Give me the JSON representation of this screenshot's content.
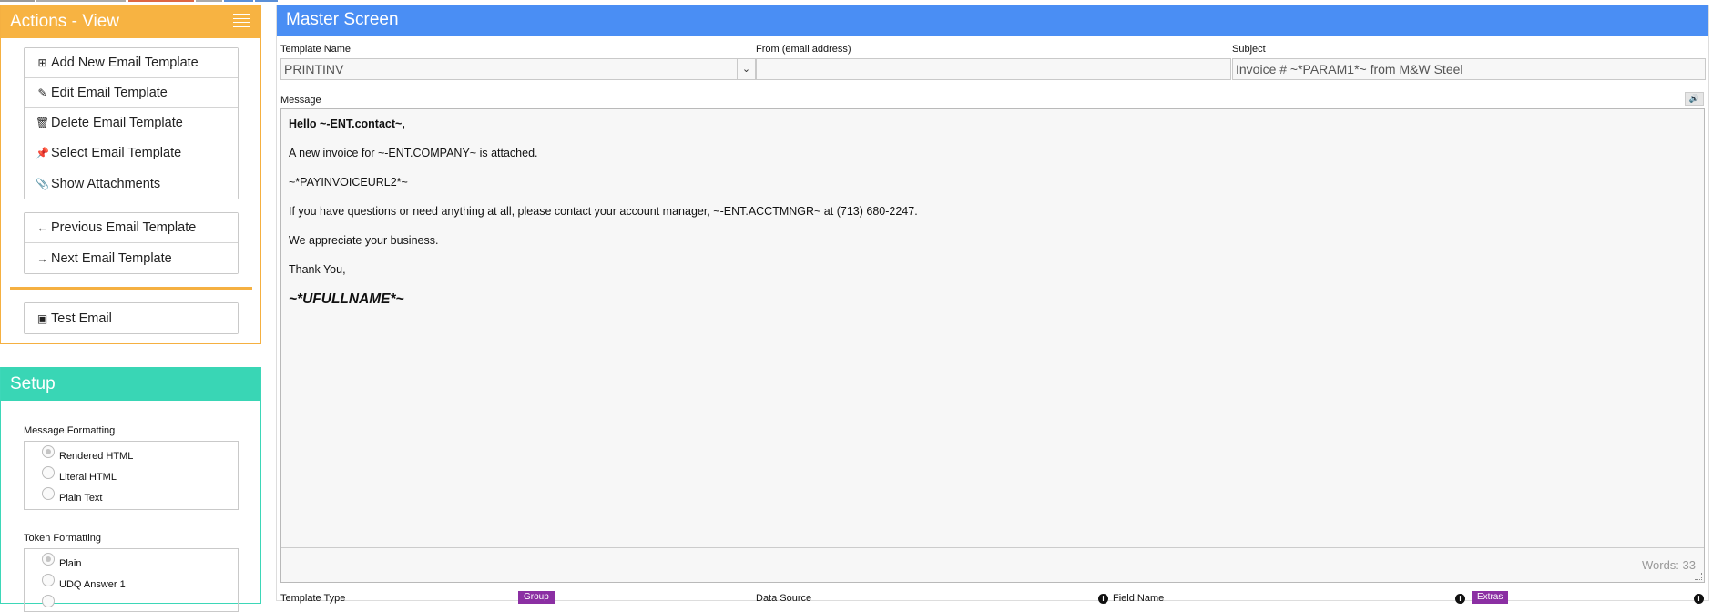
{
  "colors": {
    "actions_header": "#f7b342",
    "setup_header": "#39d6b5",
    "master_header": "#4a8ef4",
    "tag": "#8b2fa3"
  },
  "actions": {
    "title": "Actions - View",
    "group1": [
      {
        "icon": "plus-square-icon",
        "label": "Add New Email Template"
      },
      {
        "icon": "pencil-icon",
        "label": "Edit Email Template"
      },
      {
        "icon": "trash-icon",
        "label": "Delete Email Template"
      },
      {
        "icon": "pin-icon",
        "label": "Select Email Template"
      },
      {
        "icon": "paperclip-icon",
        "label": "Show Attachments"
      }
    ],
    "group2": [
      {
        "icon": "arrow-left-icon",
        "label": "Previous Email Template"
      },
      {
        "icon": "arrow-right-icon",
        "label": "Next Email Template"
      }
    ],
    "group3": [
      {
        "icon": "image-icon",
        "label": "Test Email"
      }
    ]
  },
  "setup": {
    "title": "Setup",
    "message_formatting": {
      "label": "Message Formatting",
      "options": [
        "Rendered HTML",
        "Literal HTML",
        "Plain Text"
      ],
      "selected": "Rendered HTML"
    },
    "token_formatting": {
      "label": "Token Formatting",
      "options": [
        "Plain",
        "UDQ Answer 1"
      ],
      "selected": "Plain"
    }
  },
  "master": {
    "title": "Master Screen",
    "template_name": {
      "label": "Template Name",
      "value": "PRINTINV"
    },
    "from": {
      "label": "From (email address)",
      "value": ""
    },
    "subject": {
      "label": "Subject",
      "value": "Invoice # ~*PARAM1*~ from M&W Steel"
    },
    "message": {
      "label": "Message",
      "lines": [
        "Hello ~-ENT.contact~,",
        "A new invoice for ~-ENT.COMPANY~ is attached.",
        "~*PAYINVOICEURL2*~",
        "If you have questions or need anything at all, please contact your account manager, ~-ENT.ACCTMNGR~ at (713) 680-2247.",
        "We appreciate your business.",
        "Thank You,",
        "~*UFULLNAME*~"
      ],
      "word_count": "Words: 33"
    },
    "bottom": {
      "template_type_label": "Template Type",
      "group_tag": "Group",
      "data_source_label": "Data Source",
      "field_name_label": "Field Name",
      "extras_tag": "Extras"
    }
  }
}
